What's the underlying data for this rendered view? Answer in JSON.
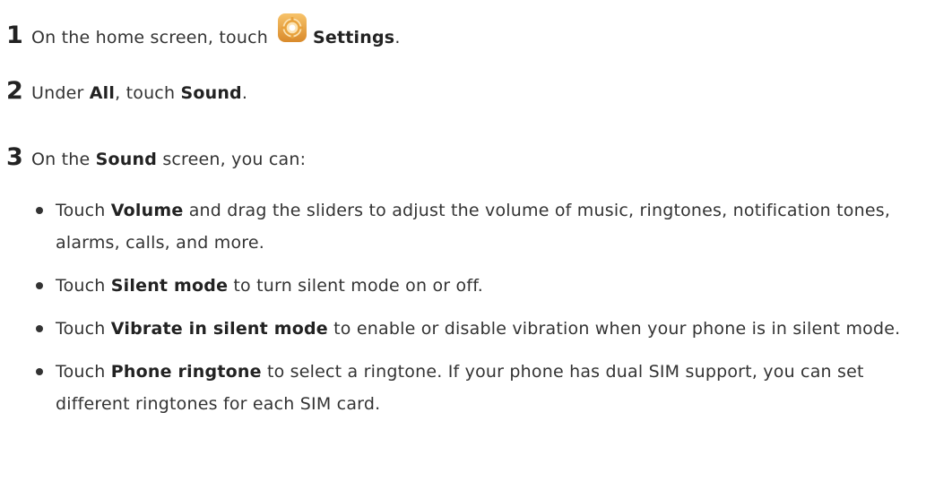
{
  "steps": [
    {
      "number": "1",
      "text_before": "On the home screen, touch",
      "bold": "Settings",
      "text_after": ".",
      "icon": "settings-gear-icon"
    },
    {
      "number": "2",
      "text_before": "Under",
      "bold1": "All",
      "text_mid": ", touch",
      "bold2": "Sound",
      "text_after": "."
    },
    {
      "number": "3",
      "text_before": "On the",
      "bold": "Sound",
      "text_after": "screen, you can:"
    }
  ],
  "bullets": [
    {
      "lead": "Touch",
      "bold": "Volume",
      "rest": "and drag the sliders to adjust the volume of music, ringtones, notification tones, alarms, calls, and more."
    },
    {
      "lead": "Touch",
      "bold": "Silent mode",
      "rest": "to turn silent mode on or off."
    },
    {
      "lead": "Touch",
      "bold": "Vibrate in silent mode",
      "rest": "to enable or disable vibration when your phone is in silent mode."
    },
    {
      "lead": "Touch",
      "bold": "Phone ringtone",
      "rest": "to select a ringtone. If your phone has dual SIM support, you can set different ringtones for each SIM card."
    }
  ],
  "colors": {
    "text": "#333333",
    "icon_gold": "#e8a23c",
    "icon_light": "#fbe3b3"
  }
}
